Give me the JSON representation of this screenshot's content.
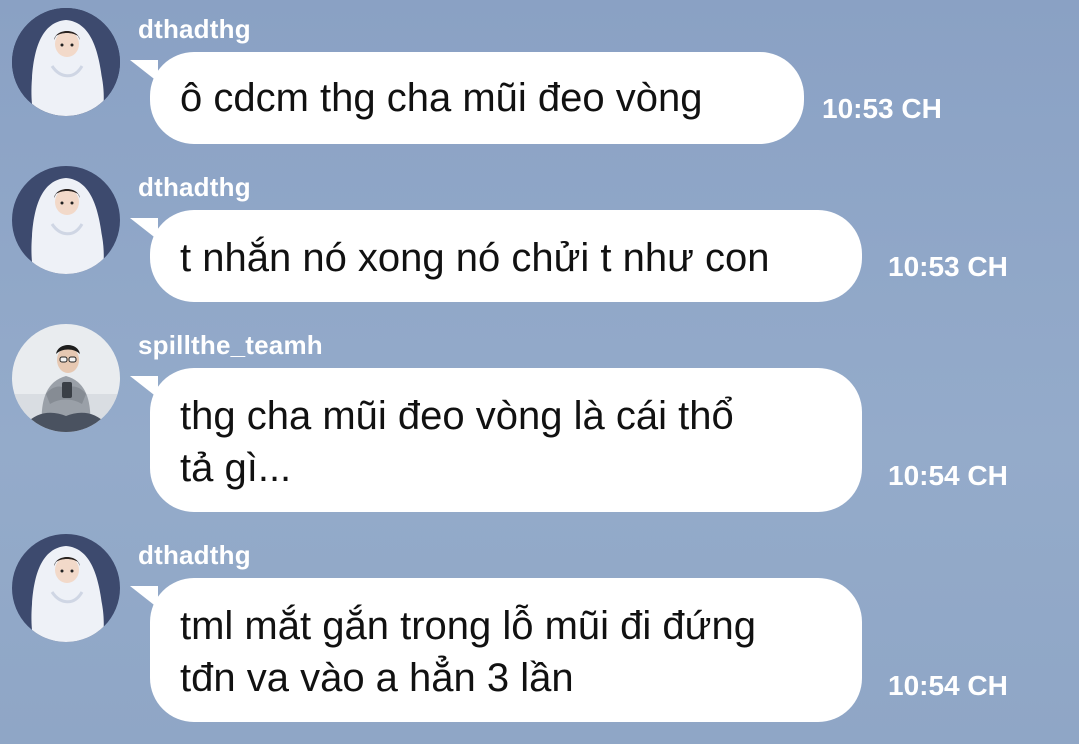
{
  "messages": [
    {
      "username": "dthadthg",
      "text_lines": [
        "ô cdcm thg cha mũi đeo vòng"
      ],
      "time": "10:53 CH",
      "avatar": "girl-blanket-avatar"
    },
    {
      "username": "dthadthg",
      "text_lines": [
        "t nhắn nó xong nó chửi t như con"
      ],
      "time": "10:53 CH",
      "avatar": "girl-blanket-avatar"
    },
    {
      "username": "spillthe_teamh",
      "text_lines": [
        "thg cha mũi đeo vòng là cái thổ",
        "tả gì..."
      ],
      "time": "10:54 CH",
      "avatar": "man-phone-avatar"
    },
    {
      "username": "dthadthg",
      "text_lines": [
        "tml mắt gắn trong lỗ mũi đi đứng",
        "tđn va vào a hẳn 3 lần"
      ],
      "time": "10:54 CH",
      "avatar": "girl-blanket-avatar"
    }
  ],
  "colors": {
    "background": "#8fa6c6",
    "bubble": "#ffffff",
    "text": "#111111",
    "meta": "#ffffff"
  }
}
